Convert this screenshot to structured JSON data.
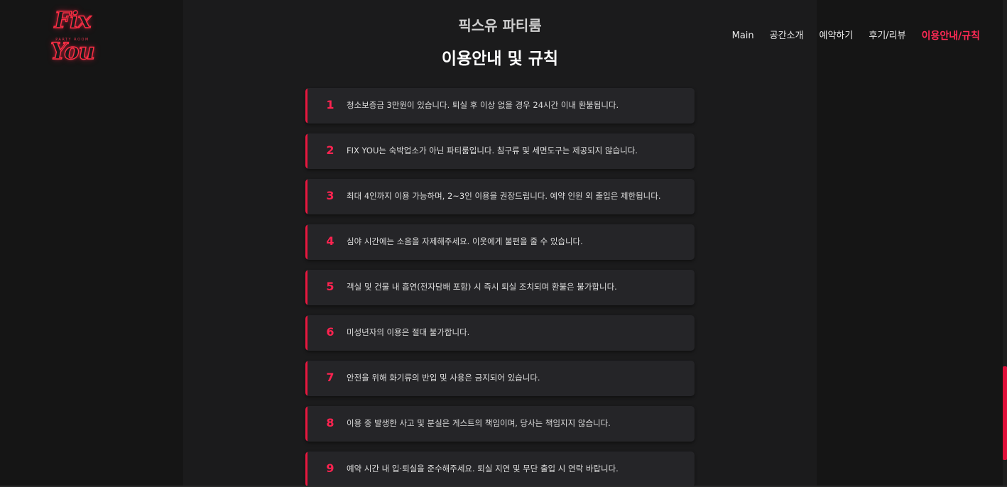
{
  "brand": {
    "logo_text": "Fix You",
    "logo_subtitle": "PARTY ROOM",
    "site_title": "픽스유 파티룸"
  },
  "nav": {
    "items": [
      {
        "label": "Main",
        "active": false
      },
      {
        "label": "공간소개",
        "active": false
      },
      {
        "label": "예약하기",
        "active": false
      },
      {
        "label": "후기/리뷰",
        "active": false
      },
      {
        "label": "이용안내/규칙",
        "active": true
      }
    ]
  },
  "page": {
    "heading": "이용안내 및 규칙"
  },
  "rules": [
    {
      "number": "1",
      "text": "청소보증금 3만원이 있습니다. 퇴실 후 이상 없을 경우 24시간 이내 환불됩니다."
    },
    {
      "number": "2",
      "text": "FIX YOU는 숙박업소가 아닌 파티룸입니다. 침구류 및 세면도구는 제공되지 않습니다."
    },
    {
      "number": "3",
      "text": "최대 4인까지 이용 가능하며, 2~3인 이용을 권장드립니다. 예약 인원 외 출입은 제한됩니다."
    },
    {
      "number": "4",
      "text": "심야 시간에는 소음을 자제해주세요. 이웃에게 불편을 줄 수 있습니다."
    },
    {
      "number": "5",
      "text": "객실 및 건물 내 흡연(전자담배 포함) 시 즉시 퇴실 조치되며 환불은 불가합니다."
    },
    {
      "number": "6",
      "text": "미성년자의 이용은 절대 불가합니다."
    },
    {
      "number": "7",
      "text": "안전을 위해 화기류의 반입 및 사용은 금지되어 있습니다."
    },
    {
      "number": "8",
      "text": "이용 중 발생한 사고 및 분실은 게스트의 책임이며, 당사는 책임지지 않습니다."
    },
    {
      "number": "9",
      "text": "예약 시간 내 입·퇴실을 준수해주세요. 퇴실 지연 및 무단 출입 시 연락 바랍니다."
    }
  ],
  "colors": {
    "accent": "#ff2350",
    "background": "#151515",
    "panel": "#1b1b1c",
    "card": "#252528"
  }
}
